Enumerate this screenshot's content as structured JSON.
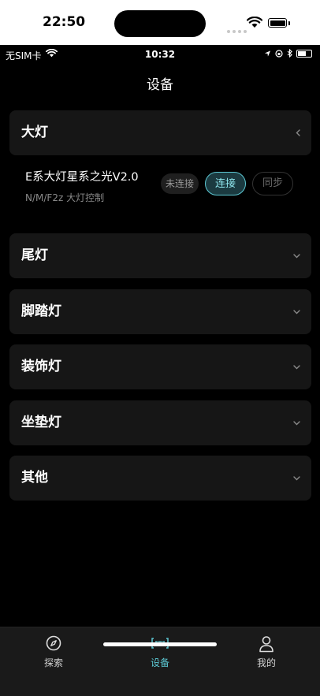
{
  "outer_status": {
    "time": "22:50"
  },
  "inner_status": {
    "carrier": "无SIM卡",
    "time": "10:32"
  },
  "nav": {
    "title": "设备"
  },
  "sections": [
    {
      "title": "大灯",
      "expanded": true
    },
    {
      "title": "尾灯",
      "expanded": false
    },
    {
      "title": "脚踏灯",
      "expanded": false
    },
    {
      "title": "装饰灯",
      "expanded": false
    },
    {
      "title": "坐垫灯",
      "expanded": false
    },
    {
      "title": "其他",
      "expanded": false
    }
  ],
  "device": {
    "name": "E系大灯星系之光V2.0",
    "subtitle": "N/M/F2z 大灯控制",
    "status": "未连接",
    "connect_label": "连接",
    "sync_label": "同步"
  },
  "tabbar": {
    "tabs": [
      {
        "label": "探索",
        "icon": "compass-icon",
        "active": false
      },
      {
        "label": "设备",
        "icon": "device-icon",
        "active": true
      },
      {
        "label": "我的",
        "icon": "profile-icon",
        "active": false
      }
    ]
  },
  "colors": {
    "accent": "#5cc8d3",
    "background": "#000000",
    "card": "#161616",
    "tabbar": "#1a1a1a"
  }
}
